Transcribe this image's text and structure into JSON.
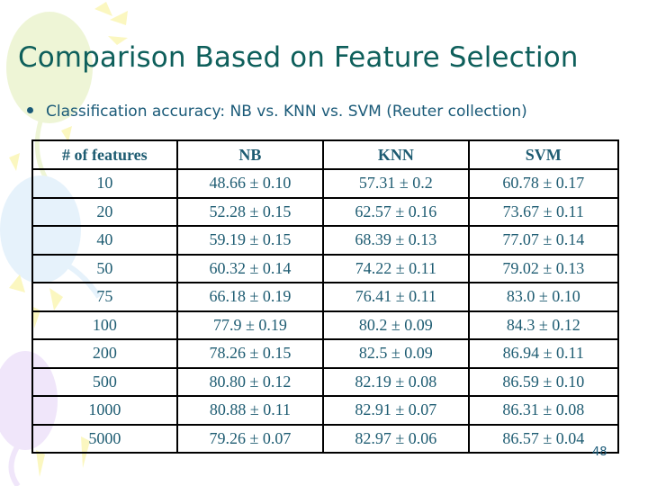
{
  "slide": {
    "title": "Comparison Based on Feature Selection",
    "bullet": "Classification accuracy: NB vs. KNN vs. SVM (Reuter collection)",
    "page_number": "48"
  },
  "table": {
    "headers": [
      "# of features",
      "NB",
      "KNN",
      "SVM"
    ],
    "rows": [
      [
        "10",
        "48.66 ± 0.10",
        "57.31 ± 0.2",
        "60.78 ± 0.17"
      ],
      [
        "20",
        "52.28 ± 0.15",
        "62.57 ± 0.16",
        "73.67 ± 0.11"
      ],
      [
        "40",
        "59.19 ± 0.15",
        "68.39 ± 0.13",
        "77.07 ± 0.14"
      ],
      [
        "50",
        "60.32 ± 0.14",
        "74.22 ± 0.11",
        "79.02 ± 0.13"
      ],
      [
        "75",
        "66.18 ± 0.19",
        "76.41 ± 0.11",
        "83.0 ± 0.10"
      ],
      [
        "100",
        "77.9 ± 0.19",
        "80.2 ± 0.09",
        "84.3 ± 0.12"
      ],
      [
        "200",
        "78.26 ± 0.15",
        "82.5 ± 0.09",
        "86.94 ± 0.11"
      ],
      [
        "500",
        "80.80 ± 0.12",
        "82.19 ± 0.08",
        "86.59 ± 0.10"
      ],
      [
        "1000",
        "80.88 ± 0.11",
        "82.91 ± 0.07",
        "86.31 ± 0.08"
      ],
      [
        "5000",
        "79.26 ± 0.07",
        "82.97 ± 0.06",
        "86.57 ± 0.04"
      ]
    ]
  },
  "theme": {
    "title_color": "#0e5f5b",
    "text_color": "#1a5a78",
    "table_text_color": "#1e5c72",
    "balloon_green": "#eef5d6",
    "balloon_blue": "#e6f2fb",
    "balloon_purple": "#f0e6fa",
    "ray_yellow": "#fbf7c0"
  }
}
